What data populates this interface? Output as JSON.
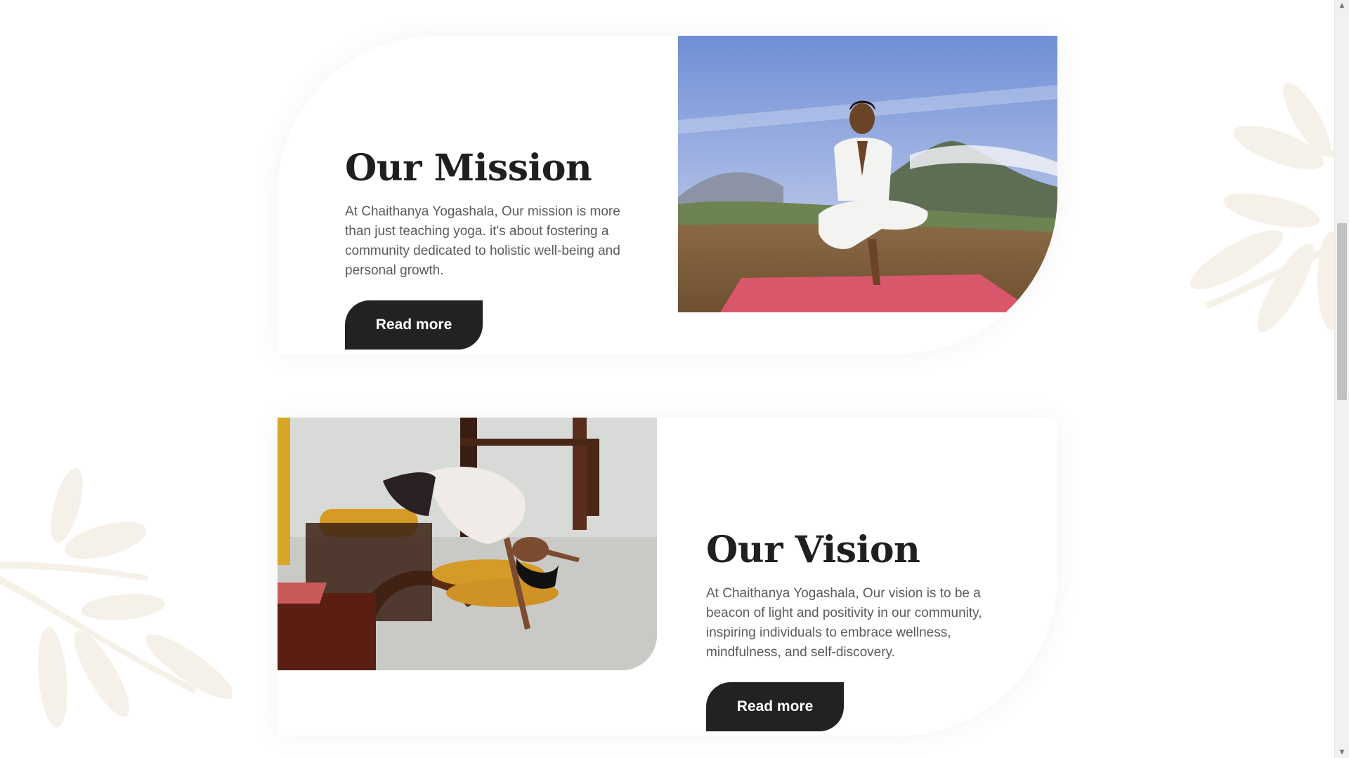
{
  "sections": {
    "mission": {
      "title": "Our Mission",
      "body": "At Chaithanya Yogashala, Our mission is more than just teaching yoga. it's about fostering a community dedicated to holistic well-being and personal growth.",
      "button_label": "Read more",
      "image_alt": "Man in white clothes doing a yoga balance pose with hands in prayer on a red mat atop a mountain"
    },
    "vision": {
      "title": "Our Vision",
      "body": "At Chaithanya Yogashala, Our vision is to be a beacon of light and positivity in our community, inspiring individuals to embrace wellness, mindfulness, and self-discovery.",
      "button_label": "Read more",
      "image_alt": "Woman doing a supported backbend over a wooden yoga prop with yellow bolsters"
    }
  },
  "colors": {
    "button_bg": "#222222",
    "title": "#1f1f1f",
    "body_text": "#5b5b5b",
    "leaf_deco": "#f6f1e8"
  },
  "scrollbar": {
    "up_icon": "triangle-up-icon",
    "down_icon": "triangle-down-icon"
  }
}
